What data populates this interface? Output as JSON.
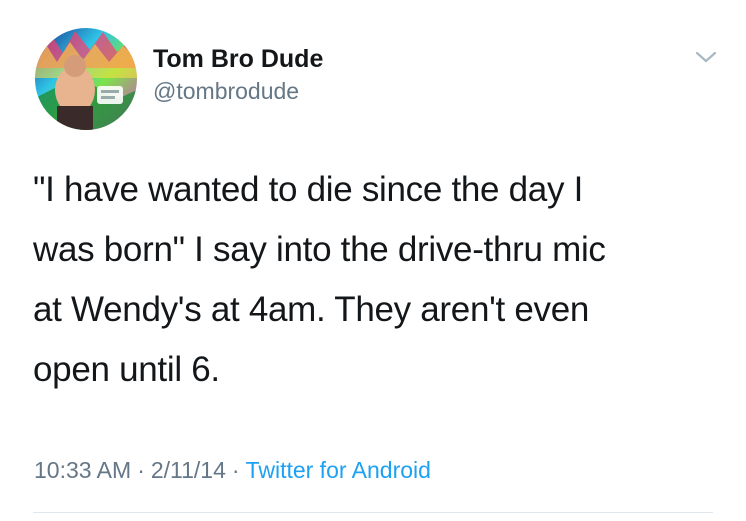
{
  "tweet": {
    "author": {
      "display_name": "Tom Bro Dude",
      "handle": "@tombrodude",
      "avatar_icon": "profile-photo"
    },
    "text_lines": [
      "\"I have wanted to die since the day I",
      "was born\" I say into the drive-thru mic",
      "at Wendy's at 4am. They aren't even",
      "open until 6."
    ],
    "time": "10:33 AM",
    "separator": "·",
    "date": "2/11/14",
    "source": "Twitter for Android",
    "menu_icon": "chevron-down-icon"
  },
  "colors": {
    "text": "#14171a",
    "secondary": "#657786",
    "link": "#1da1f2",
    "divider": "#e1e8ed"
  }
}
